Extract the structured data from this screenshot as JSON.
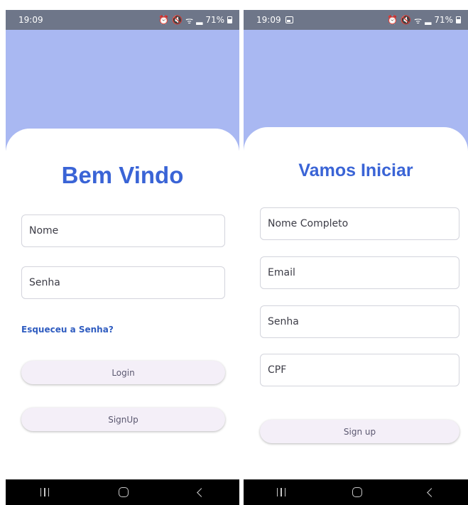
{
  "login": {
    "status": {
      "time": "19:09",
      "battery": "71%"
    },
    "title": "Bem Vindo",
    "fields": [
      {
        "placeholder": "Nome"
      },
      {
        "placeholder": "Senha"
      }
    ],
    "forgot_link": "Esqueceu a Senha?",
    "login_button": "Login",
    "signup_button": "SignUp"
  },
  "signup": {
    "status": {
      "time": "19:09",
      "battery": "71%"
    },
    "title": "Vamos Iniciar",
    "fields": [
      {
        "placeholder": "Nome Completo"
      },
      {
        "placeholder": "Email"
      },
      {
        "placeholder": "Senha"
      },
      {
        "placeholder": "CPF"
      }
    ],
    "signup_button": "Sign up"
  },
  "colors": {
    "header": "#a9b8f2",
    "title": "#3a64d6",
    "link": "#2f5cc0",
    "button_bg": "#f4eff8",
    "status_bar": "#6e7689",
    "nav_bar": "#000000"
  },
  "icons": {
    "status_right": [
      "alarm-icon",
      "mute-icon",
      "wifi-icon",
      "signal-icon",
      "battery-icon"
    ],
    "status_left_signup": [
      "gallery-icon"
    ],
    "nav": [
      "recents-icon",
      "home-icon",
      "back-icon"
    ]
  }
}
